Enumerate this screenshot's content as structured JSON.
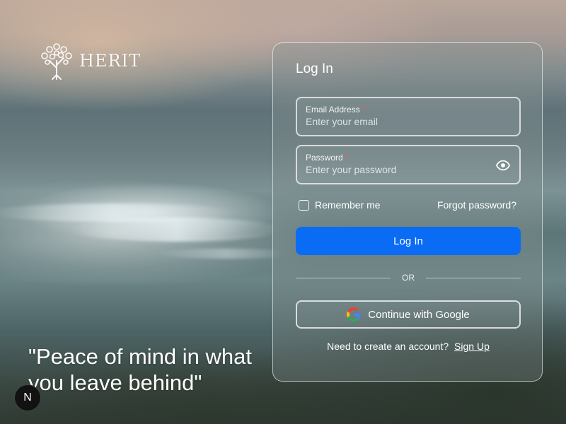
{
  "brand": {
    "name": "HERIT",
    "logo_icon": "tree-icon"
  },
  "quote": "\"Peace of mind in what you leave behind\"",
  "next_badge": "N",
  "login_card": {
    "title": "Log In",
    "email": {
      "label": "Email Address",
      "required_mark": "*",
      "placeholder": "Enter your email",
      "value": ""
    },
    "password": {
      "label": "Password",
      "required_mark": "*",
      "placeholder": "Enter your password",
      "value": "",
      "toggle_icon": "eye-icon"
    },
    "remember_label": "Remember me",
    "forgot_label": "Forgot password?",
    "login_button": "Log In",
    "divider_text": "OR",
    "google_button": "Continue with Google",
    "google_icon": "google-icon",
    "signup_prompt": "Need to create an account?",
    "signup_link": "Sign Up"
  },
  "colors": {
    "primary_button": "#0a6cf5",
    "required": "#ff4d6d"
  }
}
